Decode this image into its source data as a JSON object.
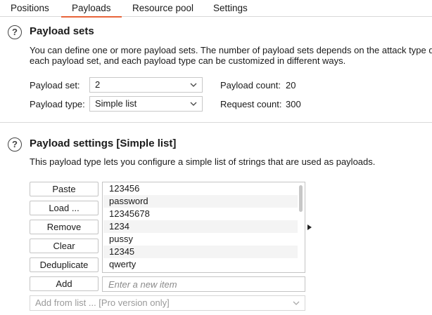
{
  "tabs": [
    {
      "label": "Positions",
      "active": false
    },
    {
      "label": "Payloads",
      "active": true
    },
    {
      "label": "Resource pool",
      "active": false
    },
    {
      "label": "Settings",
      "active": false
    }
  ],
  "accent_color": "#e8643a",
  "payload_sets": {
    "help_icon": "question-circle-icon",
    "title": "Payload sets",
    "description_line1": "You can define one or more payload sets. The number of payload sets depends on the attack type d",
    "description_line2": "each payload set, and each payload type can be customized in different ways.",
    "payload_set_label": "Payload set:",
    "payload_set_value": "2",
    "payload_type_label": "Payload type:",
    "payload_type_value": "Simple list",
    "payload_count_label": "Payload count:",
    "payload_count_value": "20",
    "request_count_label": "Request count:",
    "request_count_value": "300"
  },
  "payload_settings": {
    "help_icon": "question-circle-icon",
    "title": "Payload settings [Simple list]",
    "description": "This payload type lets you configure a simple list of strings that are used as payloads.",
    "buttons": {
      "paste": "Paste",
      "load": "Load ...",
      "remove": "Remove",
      "clear": "Clear",
      "deduplicate": "Deduplicate",
      "add": "Add"
    },
    "items": [
      "123456",
      "password",
      "12345678",
      "1234",
      "pussy",
      "12345",
      "qwerty"
    ],
    "new_item_placeholder": "Enter a new item",
    "add_from_list": "Add from list ... [Pro version only]"
  }
}
